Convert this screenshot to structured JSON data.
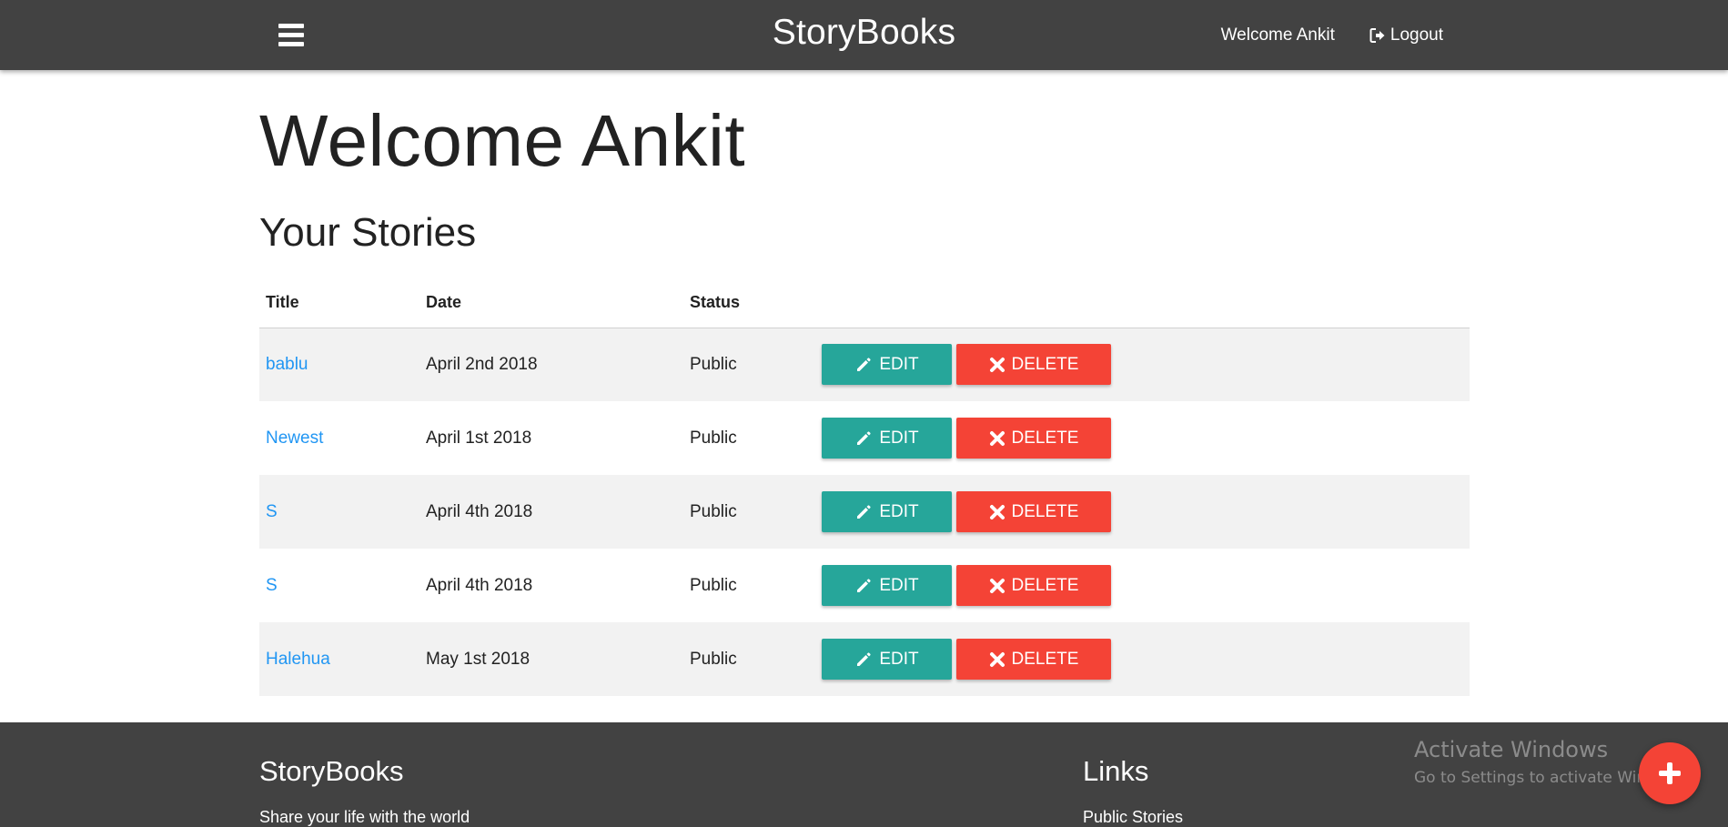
{
  "navbar": {
    "brand": "StoryBooks",
    "welcome": "Welcome Ankit",
    "logout": "Logout",
    "menu_icon": "hamburger-menu-icon",
    "logout_icon": "sign-out-icon"
  },
  "main": {
    "heading": "Welcome Ankit",
    "section_title": "Your Stories",
    "columns": [
      "Title",
      "Date",
      "Status"
    ],
    "edit_label": "EDIT",
    "delete_label": "DELETE",
    "stories": [
      {
        "title": "bablu",
        "date": "April 2nd 2018",
        "status": "Public"
      },
      {
        "title": "Newest",
        "date": "April 1st 2018",
        "status": "Public"
      },
      {
        "title": "S",
        "date": "April 4th 2018",
        "status": "Public"
      },
      {
        "title": "S",
        "date": "April 4th 2018",
        "status": "Public"
      },
      {
        "title": "Halehua",
        "date": "May 1st 2018",
        "status": "Public"
      }
    ]
  },
  "footer": {
    "brand": "StoryBooks",
    "tagline": "Share your life with the world",
    "links_title": "Links",
    "links": [
      "Public Stories"
    ]
  },
  "watermark": {
    "title": "Activate Windows",
    "subtitle": "Go to Settings to activate Windows."
  },
  "fab": {
    "icon": "plus-icon"
  },
  "colors": {
    "navbar": "#424242",
    "edit": "#26a69a",
    "delete": "#f44336",
    "link": "#2196f3",
    "stripe": "#f2f2f2"
  }
}
